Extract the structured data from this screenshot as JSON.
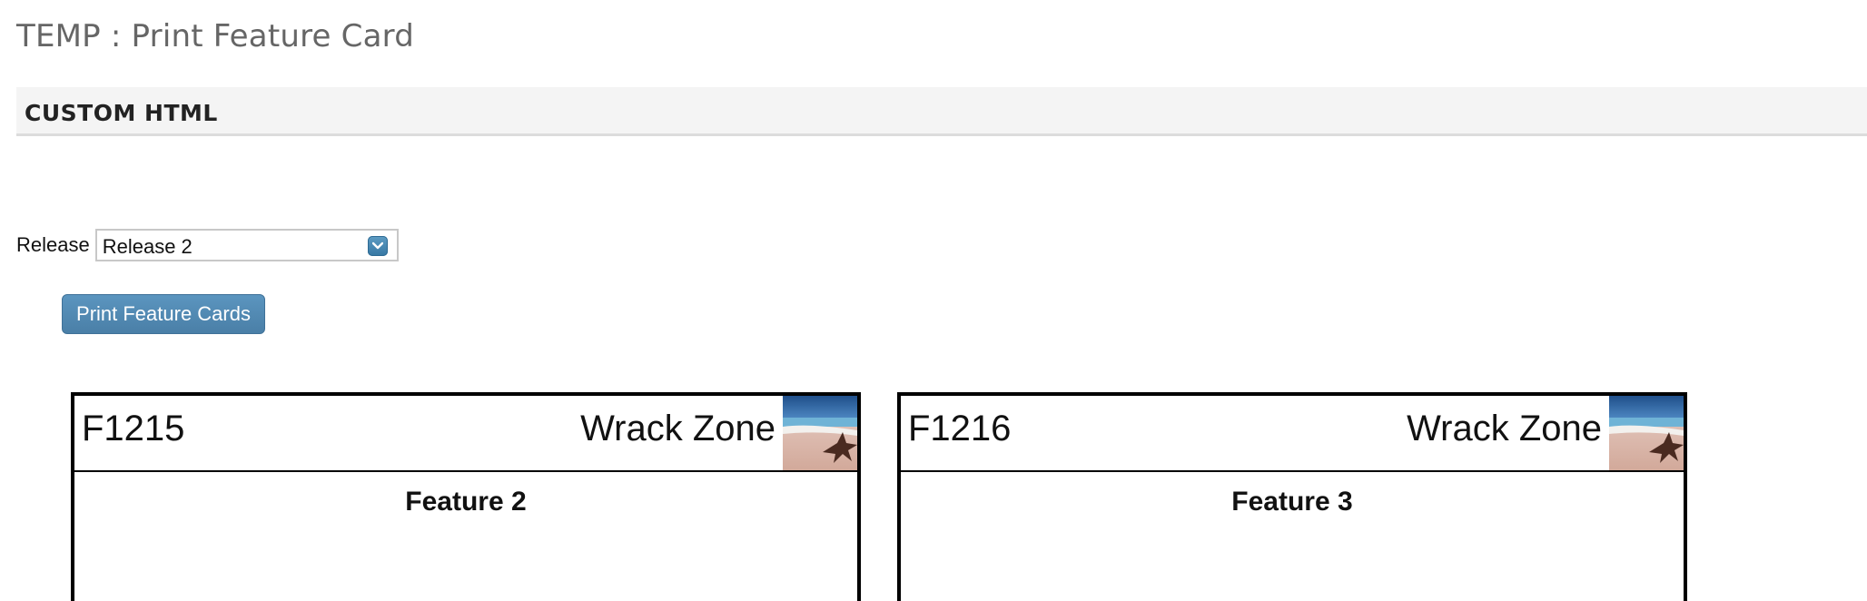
{
  "page": {
    "title": "TEMP : Print Feature Card"
  },
  "section": {
    "label": "CUSTOM HTML"
  },
  "release_filter": {
    "label": "Release",
    "selected_value": "Release 2"
  },
  "print_button": {
    "label": "Print Feature Cards"
  },
  "cards": [
    {
      "id": "F1215",
      "theme": "Wrack Zone",
      "title": "Feature 2"
    },
    {
      "id": "F1216",
      "theme": "Wrack Zone",
      "title": "Feature 3"
    }
  ],
  "colors": {
    "button_blue": "#4f87b1",
    "select_arrow_blue": "#3f7fab",
    "section_bar_bg": "#f4f4f4",
    "title_gray": "#666666"
  },
  "icons": {
    "select_arrow": "chevron-down-icon",
    "card_image": "beach-starfish-thumbnail"
  }
}
